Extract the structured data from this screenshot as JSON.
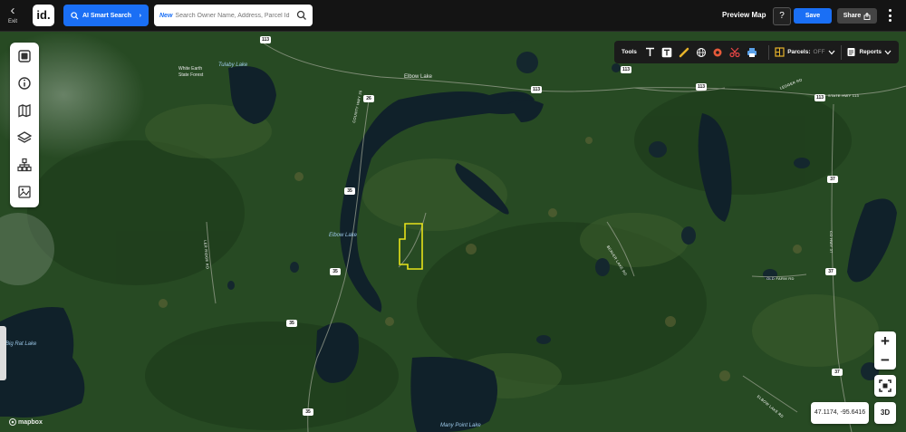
{
  "header": {
    "exit_label": "Exit",
    "logo_text": "id.",
    "ai_search_label": "AI Smart Search",
    "search_new_badge": "New",
    "search_placeholder": "Search Owner Name, Address, Parcel Id",
    "preview_label": "Preview Map",
    "help_label": "?",
    "save_label": "Save",
    "share_label": "Share"
  },
  "toolbar": {
    "tools_label": "Tools",
    "parcels_label": "Parcels:",
    "parcels_state": "OFF",
    "reports_label": "Reports"
  },
  "map": {
    "labels": {
      "tulaby_lake": "Tulaby Lake",
      "white_earth_forest_1": "White Earth",
      "white_earth_forest_2": "State Forest",
      "elbow_lake_town": "Elbow Lake",
      "elbow_lake": "Elbow Lake",
      "big_rat_lake": "Big Rat Lake",
      "many_point_lake": "Many Point Lake",
      "county_hwy_26": "COUNTY HWY 26",
      "state_hwy_113": "STATE HWY 113",
      "ler_ridge_rd": "LER RIDGE RD",
      "ledger_rd": "LEDGER RD",
      "beaver_lake_rd": "BEAVER LAKE RD",
      "old_farm_rd": "OLD FARM RD",
      "cty_37": "CO HWY 37",
      "elbow_lake_rd": "ELBOW LAKE RD"
    },
    "shields": [
      "113",
      "113",
      "113",
      "113",
      "113",
      "26",
      "35",
      "35",
      "35",
      "35",
      "37",
      "37",
      "37"
    ]
  },
  "controls": {
    "zoom_in": "+",
    "zoom_out": "−",
    "coordinates": "47.1174, -95.6416",
    "three_d": "3D",
    "attribution": "mapbox"
  },
  "colors": {
    "accent": "#1a6ff5",
    "parcel_outline": "#e6e21a"
  }
}
